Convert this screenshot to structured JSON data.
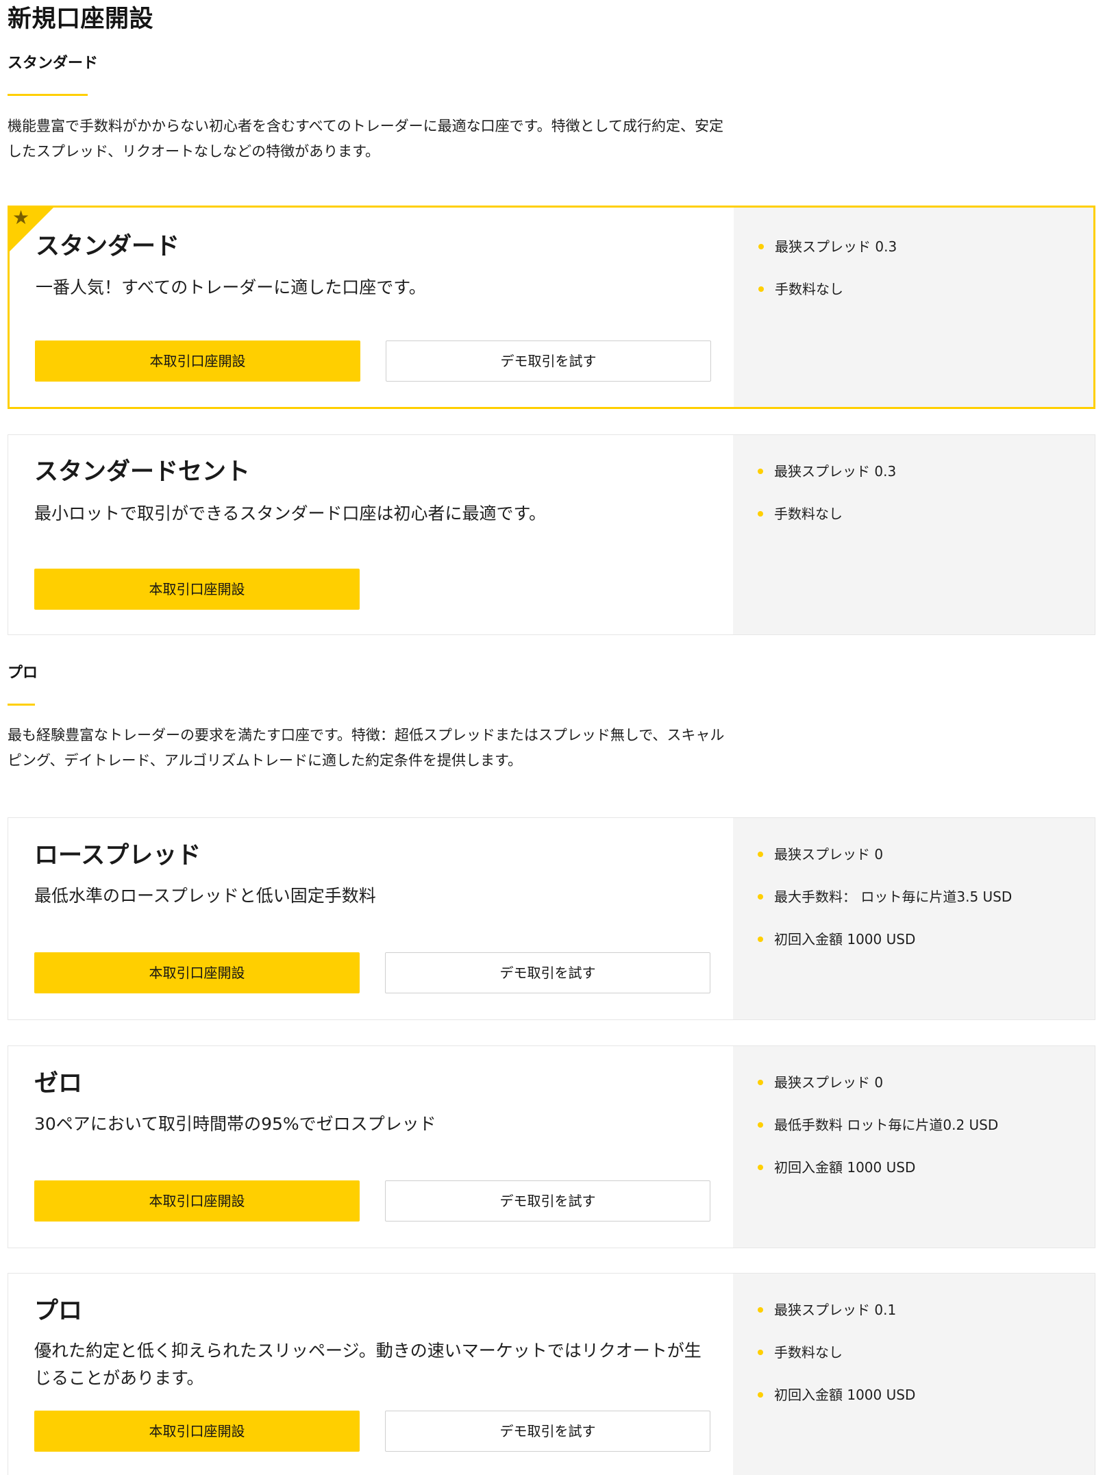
{
  "page": {
    "title": "新規口座開設"
  },
  "colors": {
    "accent": "#ffcf00",
    "panel": "#f4f4f4",
    "border": "#e6e6e6"
  },
  "sections": [
    {
      "title": "スタンダード",
      "description": "機能豊富で手数料がかからない初心者を含むすべてのトレーダーに最適な口座です。特徴として成行約定、安定したスプレッド、リクオートなしなどの特徴があります。",
      "cards": [
        {
          "title": "スタンダード",
          "featured": true,
          "badge_icon": "star-icon",
          "description": "一番人気！すべてのトレーダーに適した口座です。",
          "primary_label": "本取引口座開設",
          "secondary_label": "デモ取引を試す",
          "features": [
            "最狭スプレッド 0.3",
            "手数料なし"
          ]
        },
        {
          "title": "スタンダードセント",
          "description": "最小ロットで取引ができるスタンダード口座は初心者に最適です。",
          "primary_label": "本取引口座開設",
          "features": [
            "最狭スプレッド 0.3",
            "手数料なし"
          ]
        }
      ]
    },
    {
      "title": "プロ",
      "description": "最も経験豊富なトレーダーの要求を満たす口座です。特徴：超低スプレッドまたはスプレッド無しで、スキャルピング、デイトレード、アルゴリズムトレードに適した約定条件を提供します。",
      "cards": [
        {
          "title": "ロースプレッド",
          "description": "最低水準のロースプレッドと低い固定手数料",
          "primary_label": "本取引口座開設",
          "secondary_label": "デモ取引を試す",
          "features": [
            "最狭スプレッド 0",
            "最大手数料： ロット毎に片道3.5 USD",
            "初回入金額 1000 USD"
          ]
        },
        {
          "title": "ゼロ",
          "description": "30ペアにおいて取引時間帯の95%でゼロスプレッド",
          "primary_label": "本取引口座開設",
          "secondary_label": "デモ取引を試す",
          "features": [
            "最狭スプレッド 0",
            "最低手数料 ロット毎に片道0.2 USD",
            "初回入金額 1000 USD"
          ]
        },
        {
          "title": "プロ",
          "description": "優れた約定と低く抑えられたスリッページ。動きの速いマーケットではリクオートが生じることがあります。",
          "primary_label": "本取引口座開設",
          "secondary_label": "デモ取引を試す",
          "features": [
            "最狭スプレッド 0.1",
            "手数料なし",
            "初回入金額 1000 USD"
          ]
        }
      ]
    }
  ]
}
